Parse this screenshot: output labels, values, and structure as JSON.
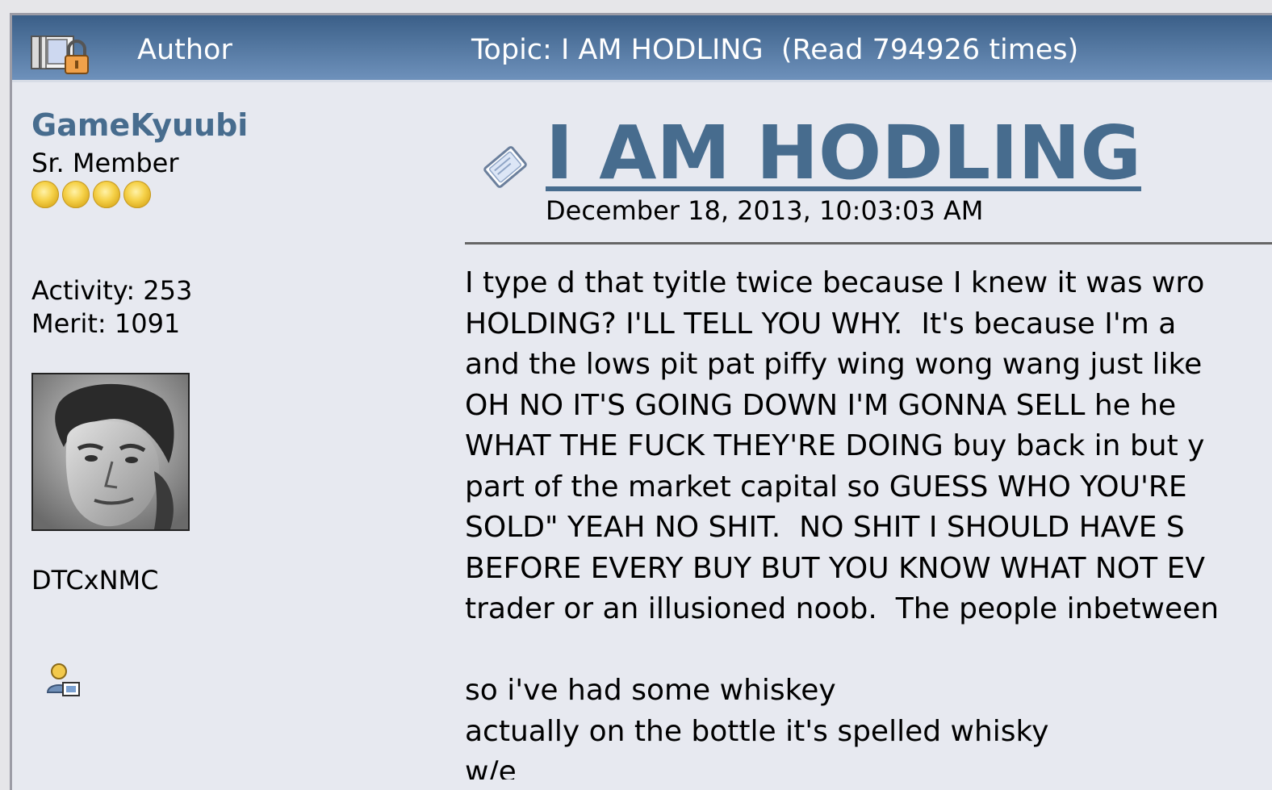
{
  "header": {
    "author_label": "Author",
    "topic_text": "Topic: I AM HODLING  (Read 794926 times)",
    "icon": "locked-topic-icon"
  },
  "poster": {
    "name": "GameKyuubi",
    "rank": "Sr. Member",
    "stars": 4,
    "activity_line": "Activity: 253",
    "merit_line": "Merit: 1091",
    "tag": "DTCxNMC",
    "avatar_icon": "user-avatar",
    "profile_icon": "user-profile-icon"
  },
  "post": {
    "title": "I AM HODLING",
    "date": "December 18, 2013, 10:03:03 AM",
    "title_icon": "post-message-icon",
    "lines": [
      "I type d that tyitle twice because I knew it was wro",
      "HOLDING? I'LL TELL YOU WHY.  It's because I'm a",
      "and the lows pit pat piffy wing wong wang just like",
      "OH NO IT'S GOING DOWN I'M GONNA SELL he he",
      "WHAT THE FUCK THEY'RE DOING buy back in but y",
      "part of the market capital so GUESS WHO YOU'RE",
      "SOLD\" YEAH NO SHIT.  NO SHIT I SHOULD HAVE S",
      "BEFORE EVERY BUY BUT YOU KNOW WHAT NOT EV",
      "trader or an illusioned noob.  The people inbetween",
      "",
      "so i've had some whiskey",
      "actually on the bottle it's spelled whisky",
      "w/e"
    ]
  }
}
